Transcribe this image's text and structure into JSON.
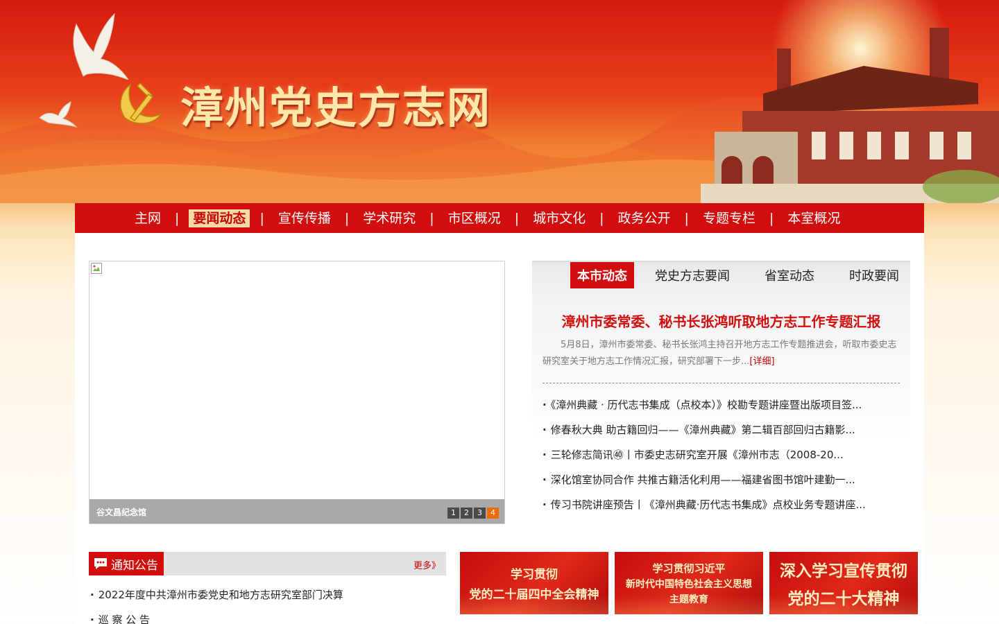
{
  "header": {
    "site_title": "漳州党史方志网"
  },
  "nav": {
    "items": [
      {
        "label": "主网",
        "active": false
      },
      {
        "label": "要闻动态",
        "active": true
      },
      {
        "label": "宣传传播",
        "active": false
      },
      {
        "label": "学术研究",
        "active": false
      },
      {
        "label": "市区概况",
        "active": false
      },
      {
        "label": "城市文化",
        "active": false
      },
      {
        "label": "政务公开",
        "active": false
      },
      {
        "label": "专题专栏",
        "active": false
      },
      {
        "label": "本室概况",
        "active": false
      }
    ],
    "separator": "|"
  },
  "slider": {
    "caption": "谷文昌纪念馆",
    "dots": [
      "1",
      "2",
      "3",
      "4"
    ],
    "active_dot": "4"
  },
  "news": {
    "tabs": [
      "本市动态",
      "党史方志要闻",
      "省室动态",
      "时政要闻"
    ],
    "active_tab": "本市动态",
    "headline": "漳州市委常委、秘书长张鸿听取地方志工作专题汇报",
    "summary": "5月8日，漳州市委常委、秘书长张鸿主持召开地方志工作专题推进会，听取市委史志研究室关于地方志工作情况汇报，研究部署下一步...",
    "summary_more": "[详细]",
    "items": [
      "《漳州典藏 · 历代志书集成（点校本）》校勘专题讲座暨出版项目签...",
      "修春秋大典 助古籍回归——《漳州典藏》第二辑百部回归古籍影...",
      "三轮修志简讯㊵丨市委史志研究室开展《漳州市志（2008-20...",
      "深化馆室协同合作 共推古籍活化利用——福建省图书馆叶建勤一...",
      "传习书院讲座预告丨《漳州典藏·历代志书集成》点校业务专题讲座..."
    ]
  },
  "notice": {
    "title": "通知公告",
    "more": "更多》",
    "items": [
      "2022年度中共漳州市委党史和地方志研究室部门决算",
      "巡 察 公 告"
    ]
  },
  "banners": [
    {
      "lines": [
        "学习贯彻",
        "党的二十届四中全会精神"
      ]
    },
    {
      "lines": [
        "学习贯彻习近平",
        "新时代中国特色社会主义思想",
        "主题教育"
      ]
    },
    {
      "lines": [
        "深入学习宣传贯彻",
        "党的二十大精神"
      ]
    }
  ],
  "colors": {
    "brand_red": "#d20d0d",
    "nav_active_bg": "#f4d9a6",
    "slider_active_dot": "#ef6c00"
  }
}
